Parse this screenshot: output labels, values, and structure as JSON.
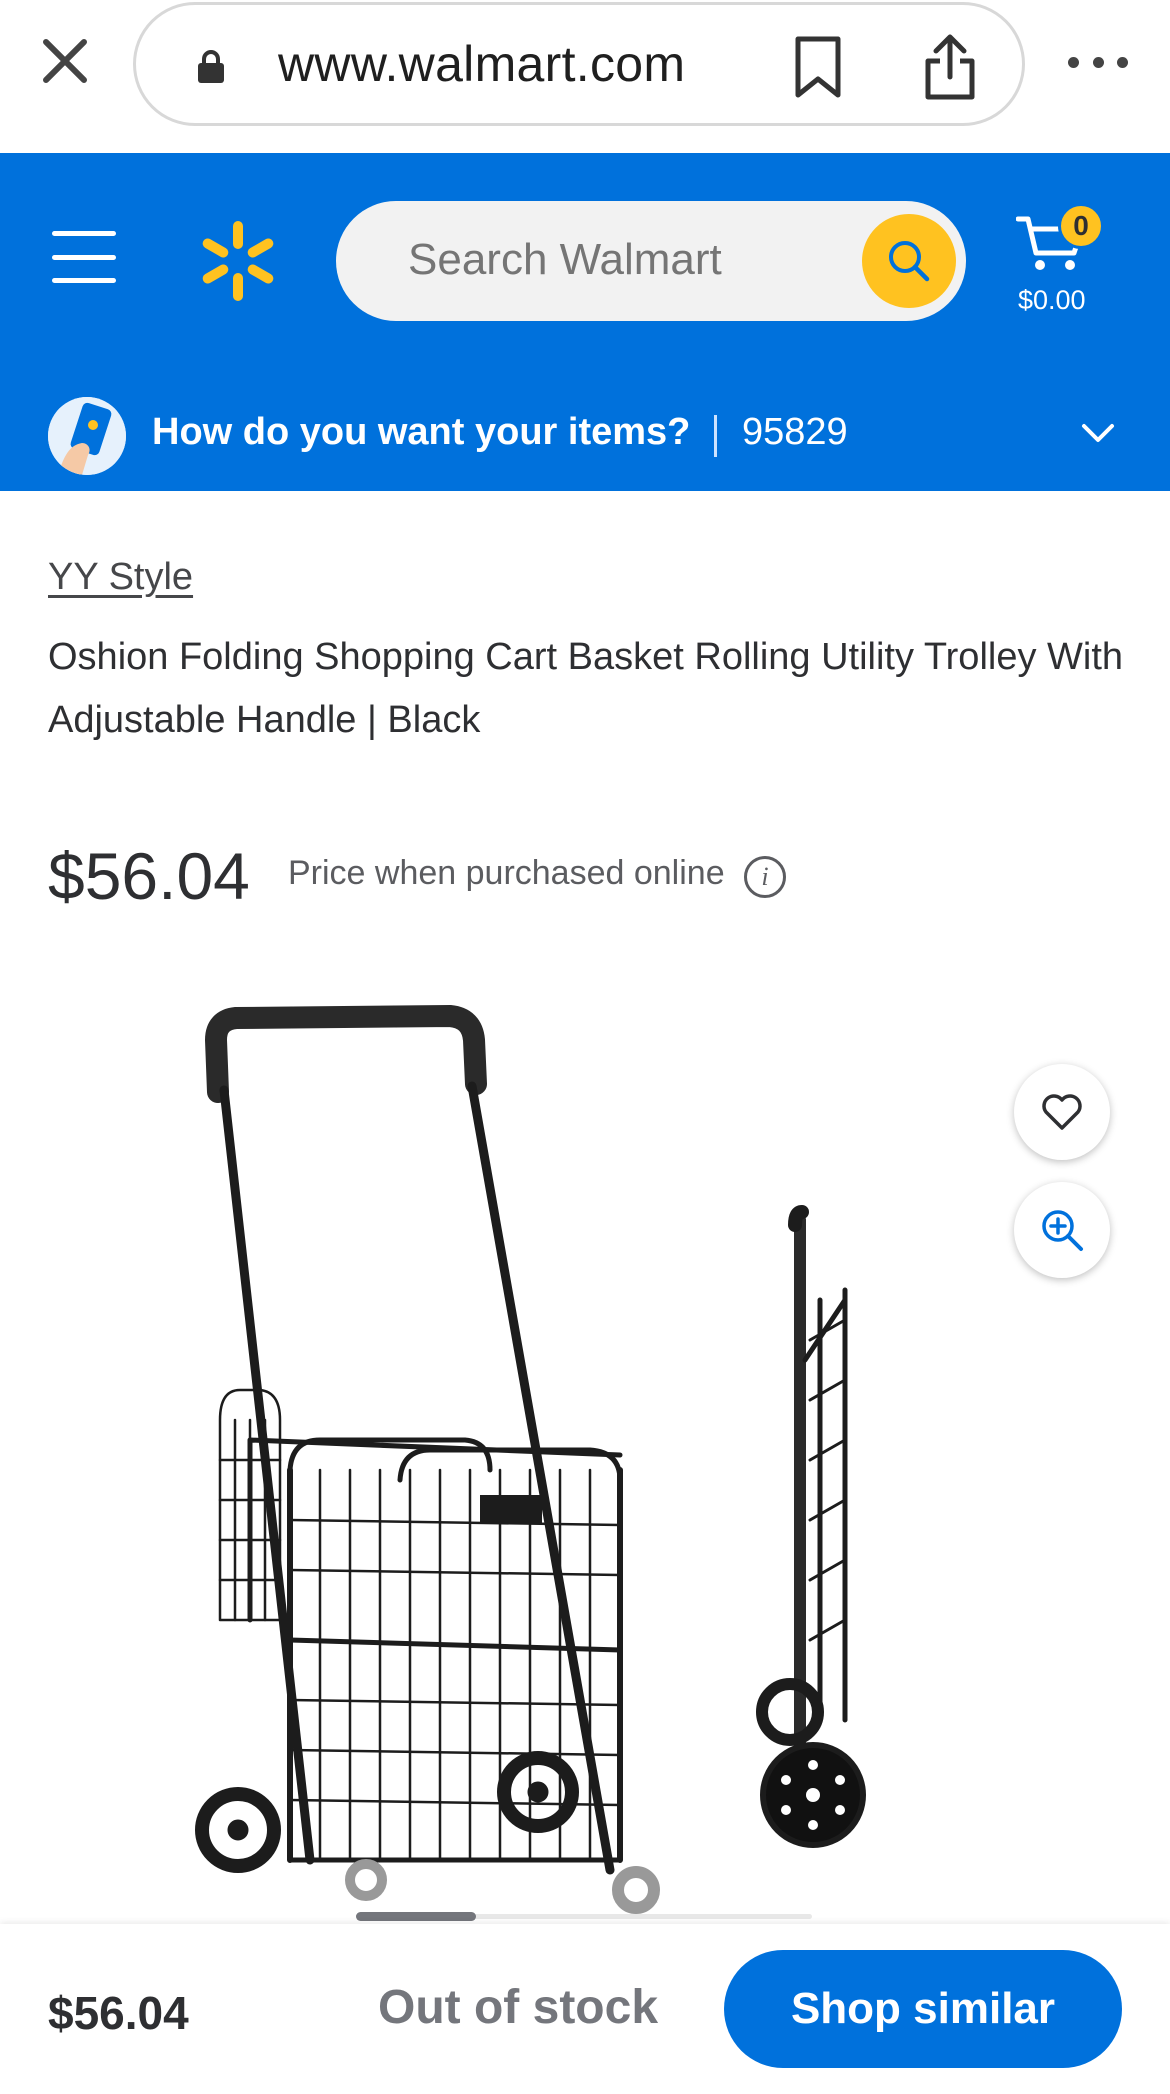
{
  "browser": {
    "url": "www.walmart.com"
  },
  "header": {
    "search_placeholder": "Search Walmart",
    "cart_count": "0",
    "cart_total": "$0.00",
    "delivery_prompt": "How do you want your items?",
    "zip": "95829",
    "brand_color": "#0071dc",
    "accent_color": "#ffc220"
  },
  "product": {
    "brand": "YY Style",
    "title": "Oshion Folding Shopping Cart Basket Rolling Utility Trolley With Adjustable Handle | Black",
    "price": "$56.04",
    "price_note": "Price when purchased online",
    "image_alt": "Folding shopping cart basket with wheels, shown open and folded"
  },
  "bottom_bar": {
    "price": "$56.04",
    "stock_status": "Out of stock",
    "cta_label": "Shop similar"
  },
  "icons": [
    "close-icon",
    "lock-icon",
    "bookmark-icon",
    "share-icon",
    "more-icon",
    "menu-icon",
    "spark-logo-icon",
    "search-icon",
    "cart-icon",
    "chevron-down-icon",
    "heart-icon",
    "zoom-in-icon",
    "info-icon"
  ]
}
